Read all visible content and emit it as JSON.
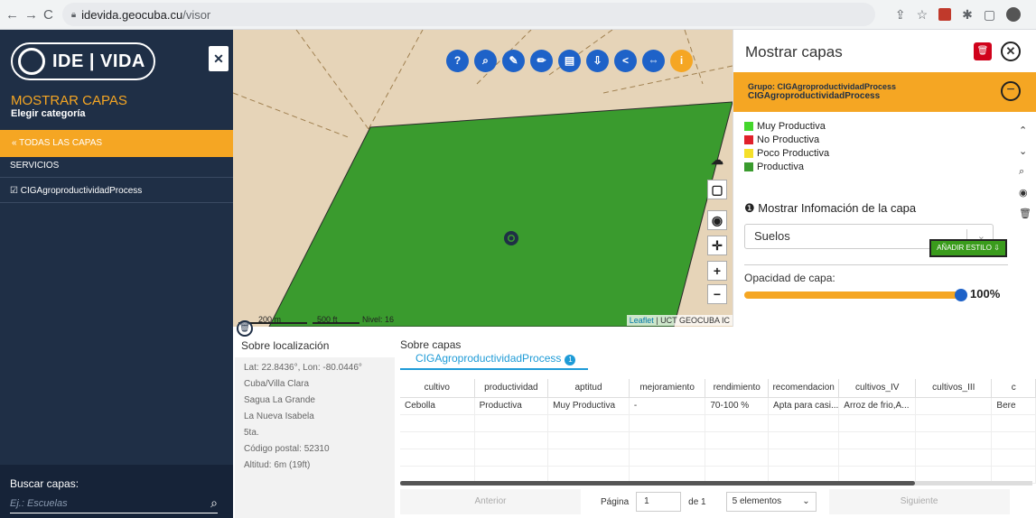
{
  "browser": {
    "url_host": "idevida.geocuba.cu",
    "url_path": "/visor",
    "back_icon": "←",
    "forward_icon": "→",
    "reload_icon": "C"
  },
  "sidebar": {
    "logo_text": "IDE | VIDA",
    "close_label": "✕",
    "title": "MOSTRAR CAPAS",
    "subtitle": "Elegir categoría",
    "all_layers": "« TODAS LAS CAPAS",
    "items": [
      {
        "label": "SERVICIOS"
      },
      {
        "label": "☑ CIGAgroproductividadProcess"
      }
    ],
    "search_label": "Buscar capas:",
    "search_placeholder": "Ej.: Escuelas"
  },
  "map": {
    "toolbar": [
      {
        "glyph": "?",
        "name": "help-icon"
      },
      {
        "glyph": "⌕",
        "name": "search-icon"
      },
      {
        "glyph": "✎",
        "name": "edit-icon"
      },
      {
        "glyph": "✏",
        "name": "draw-icon"
      },
      {
        "glyph": "▤",
        "name": "layers-icon"
      },
      {
        "glyph": "⇩",
        "name": "download-icon"
      },
      {
        "glyph": "<",
        "name": "share-icon"
      },
      {
        "glyph": "⇔",
        "name": "swipe-icon"
      },
      {
        "glyph": "i",
        "name": "info-icon"
      }
    ],
    "controls": [
      "☁",
      "▢",
      "◉",
      "✛",
      "+",
      "−"
    ],
    "scale_m": "200 m",
    "scale_ft": "500 ft",
    "nivel": "Nivel: 16",
    "attribution_link": "Leaflet",
    "attribution_rest": " | UCT GEOCUBA IC",
    "parcel_color": "#3a9b2e"
  },
  "panel": {
    "title": "Mostrar capas",
    "group_line1": "Grupo: CIGAgroproductividadProcess",
    "group_line2": "CIGAgroproductividadProcess",
    "legend": [
      {
        "label": "Muy Productiva",
        "color": "#44d62c"
      },
      {
        "label": "No Productiva",
        "color": "#e0202a"
      },
      {
        "label": "Poco Productiva",
        "color": "#f5e02a"
      },
      {
        "label": "Productiva",
        "color": "#3a9b2e"
      }
    ],
    "info_label": "❶ Mostrar Infomación de la capa",
    "select_value": "Suelos",
    "add_style": "AÑADIR ESTILO ⇩",
    "opacity_label": "Opacidad de capa:",
    "opacity_value": "100%",
    "opacity": 1.0
  },
  "location": {
    "title": "Sobre localización",
    "lines": [
      "Lat: 22.8436°, Lon: -80.0446°",
      "Cuba/Villa Clara",
      "Sagua La Grande",
      "La Nueva Isabela",
      "5ta.",
      "Código postal: 52310",
      "Altitud: 6m (19ft)"
    ]
  },
  "layers": {
    "title": "Sobre capas",
    "tab_label": "CIGAgroproductividadProcess",
    "tab_count": "1",
    "columns": [
      "cultivo",
      "productividad",
      "aptitud",
      "mejoramiento",
      "rendimiento",
      "recomendacion",
      "cultivos_IV",
      "cultivos_III",
      "c"
    ],
    "rows": [
      [
        "Cebolla",
        "Productiva",
        "Muy Productiva",
        "-",
        "70-100 %",
        "Apta para casi...",
        "Arroz de frio,A...",
        "",
        "Bere"
      ]
    ],
    "prev": "Anterior",
    "page_label": "Página",
    "page_value": "1",
    "of_label": "de 1",
    "per_page": "5 elementos",
    "next": "Siguiente"
  }
}
